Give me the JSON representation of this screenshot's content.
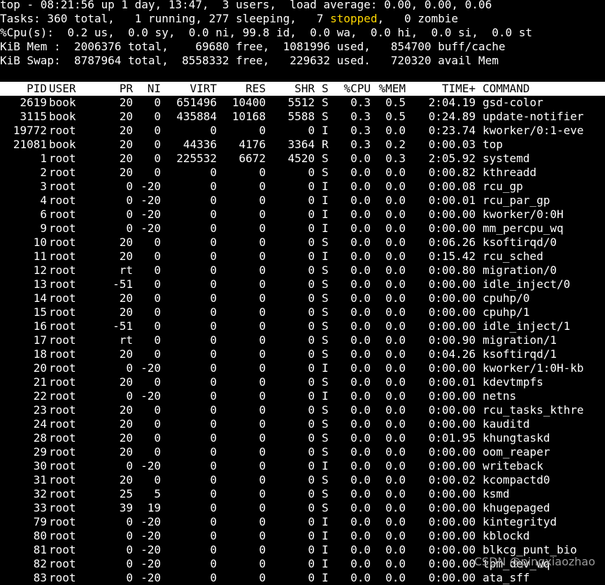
{
  "summary": {
    "line1": "top - 08:21:56 up 1 day, 13:47,  3 users,  load average: 0.00, 0.00, 0.06",
    "line2_a": "Tasks: 360 total,   1 running, 277 sleeping,   7 ",
    "line2_stopped": "stopped",
    "line2_b": ",   0 zombie",
    "line3": "%Cpu(s):  0.2 us,  0.0 sy,  0.0 ni, 99.8 id,  0.0 wa,  0.0 hi,  0.0 si,  0.0 st",
    "line4": "KiB Mem :  2006376 total,    69680 free,  1081996 used,   854700 buff/cache",
    "line5": "KiB Swap:  8787964 total,  8558332 free,   229632 used.   720320 avail Mem"
  },
  "columns": [
    "PID",
    "USER",
    "PR",
    "NI",
    "VIRT",
    "RES",
    "SHR",
    "S",
    "%CPU",
    "%MEM",
    "TIME+",
    "COMMAND"
  ],
  "processes": [
    [
      "2619",
      "book",
      "20",
      "0",
      "651496",
      "10400",
      "5512",
      "S",
      "0.3",
      "0.5",
      "2:04.19",
      "gsd-color"
    ],
    [
      "3115",
      "book",
      "20",
      "0",
      "435884",
      "10168",
      "5588",
      "S",
      "0.3",
      "0.5",
      "0:24.89",
      "update-notifier"
    ],
    [
      "19772",
      "root",
      "20",
      "0",
      "0",
      "0",
      "0",
      "I",
      "0.3",
      "0.0",
      "0:23.74",
      "kworker/0:1-eve"
    ],
    [
      "21081",
      "book",
      "20",
      "0",
      "44336",
      "4176",
      "3364",
      "R",
      "0.3",
      "0.2",
      "0:00.03",
      "top"
    ],
    [
      "1",
      "root",
      "20",
      "0",
      "225532",
      "6672",
      "4520",
      "S",
      "0.0",
      "0.3",
      "2:05.92",
      "systemd"
    ],
    [
      "2",
      "root",
      "20",
      "0",
      "0",
      "0",
      "0",
      "S",
      "0.0",
      "0.0",
      "0:00.82",
      "kthreadd"
    ],
    [
      "3",
      "root",
      "0",
      "-20",
      "0",
      "0",
      "0",
      "I",
      "0.0",
      "0.0",
      "0:00.08",
      "rcu_gp"
    ],
    [
      "4",
      "root",
      "0",
      "-20",
      "0",
      "0",
      "0",
      "I",
      "0.0",
      "0.0",
      "0:00.01",
      "rcu_par_gp"
    ],
    [
      "6",
      "root",
      "0",
      "-20",
      "0",
      "0",
      "0",
      "I",
      "0.0",
      "0.0",
      "0:00.00",
      "kworker/0:0H"
    ],
    [
      "9",
      "root",
      "0",
      "-20",
      "0",
      "0",
      "0",
      "I",
      "0.0",
      "0.0",
      "0:00.00",
      "mm_percpu_wq"
    ],
    [
      "10",
      "root",
      "20",
      "0",
      "0",
      "0",
      "0",
      "S",
      "0.0",
      "0.0",
      "0:06.26",
      "ksoftirqd/0"
    ],
    [
      "11",
      "root",
      "20",
      "0",
      "0",
      "0",
      "0",
      "I",
      "0.0",
      "0.0",
      "0:15.42",
      "rcu_sched"
    ],
    [
      "12",
      "root",
      "rt",
      "0",
      "0",
      "0",
      "0",
      "S",
      "0.0",
      "0.0",
      "0:00.80",
      "migration/0"
    ],
    [
      "13",
      "root",
      "-51",
      "0",
      "0",
      "0",
      "0",
      "S",
      "0.0",
      "0.0",
      "0:00.00",
      "idle_inject/0"
    ],
    [
      "14",
      "root",
      "20",
      "0",
      "0",
      "0",
      "0",
      "S",
      "0.0",
      "0.0",
      "0:00.00",
      "cpuhp/0"
    ],
    [
      "15",
      "root",
      "20",
      "0",
      "0",
      "0",
      "0",
      "S",
      "0.0",
      "0.0",
      "0:00.00",
      "cpuhp/1"
    ],
    [
      "16",
      "root",
      "-51",
      "0",
      "0",
      "0",
      "0",
      "S",
      "0.0",
      "0.0",
      "0:00.00",
      "idle_inject/1"
    ],
    [
      "17",
      "root",
      "rt",
      "0",
      "0",
      "0",
      "0",
      "S",
      "0.0",
      "0.0",
      "0:00.90",
      "migration/1"
    ],
    [
      "18",
      "root",
      "20",
      "0",
      "0",
      "0",
      "0",
      "S",
      "0.0",
      "0.0",
      "0:04.26",
      "ksoftirqd/1"
    ],
    [
      "20",
      "root",
      "0",
      "-20",
      "0",
      "0",
      "0",
      "I",
      "0.0",
      "0.0",
      "0:00.00",
      "kworker/1:0H-kb"
    ],
    [
      "21",
      "root",
      "20",
      "0",
      "0",
      "0",
      "0",
      "S",
      "0.0",
      "0.0",
      "0:00.01",
      "kdevtmpfs"
    ],
    [
      "22",
      "root",
      "0",
      "-20",
      "0",
      "0",
      "0",
      "I",
      "0.0",
      "0.0",
      "0:00.00",
      "netns"
    ],
    [
      "23",
      "root",
      "20",
      "0",
      "0",
      "0",
      "0",
      "S",
      "0.0",
      "0.0",
      "0:00.00",
      "rcu_tasks_kthre"
    ],
    [
      "24",
      "root",
      "20",
      "0",
      "0",
      "0",
      "0",
      "S",
      "0.0",
      "0.0",
      "0:00.00",
      "kauditd"
    ],
    [
      "28",
      "root",
      "20",
      "0",
      "0",
      "0",
      "0",
      "S",
      "0.0",
      "0.0",
      "0:01.95",
      "khungtaskd"
    ],
    [
      "29",
      "root",
      "20",
      "0",
      "0",
      "0",
      "0",
      "S",
      "0.0",
      "0.0",
      "0:00.00",
      "oom_reaper"
    ],
    [
      "30",
      "root",
      "0",
      "-20",
      "0",
      "0",
      "0",
      "I",
      "0.0",
      "0.0",
      "0:00.00",
      "writeback"
    ],
    [
      "31",
      "root",
      "20",
      "0",
      "0",
      "0",
      "0",
      "S",
      "0.0",
      "0.0",
      "0:00.02",
      "kcompactd0"
    ],
    [
      "32",
      "root",
      "25",
      "5",
      "0",
      "0",
      "0",
      "S",
      "0.0",
      "0.0",
      "0:00.00",
      "ksmd"
    ],
    [
      "33",
      "root",
      "39",
      "19",
      "0",
      "0",
      "0",
      "S",
      "0.0",
      "0.0",
      "0:00.00",
      "khugepaged"
    ],
    [
      "79",
      "root",
      "0",
      "-20",
      "0",
      "0",
      "0",
      "I",
      "0.0",
      "0.0",
      "0:00.00",
      "kintegrityd"
    ],
    [
      "80",
      "root",
      "0",
      "-20",
      "0",
      "0",
      "0",
      "I",
      "0.0",
      "0.0",
      "0:00.00",
      "kblockd"
    ],
    [
      "81",
      "root",
      "0",
      "-20",
      "0",
      "0",
      "0",
      "I",
      "0.0",
      "0.0",
      "0:00.00",
      "blkcg_punt_bio"
    ],
    [
      "82",
      "root",
      "0",
      "-20",
      "0",
      "0",
      "0",
      "I",
      "0.0",
      "0.0",
      "0:00.00",
      "tpm_dev_wq"
    ],
    [
      "83",
      "root",
      "0",
      "-20",
      "0",
      "0",
      "0",
      "I",
      "0.0",
      "0.0",
      "0:00.00",
      "ata_sff"
    ]
  ],
  "watermark": "CSDN @pingxiaozhao",
  "colors": {
    "background": "#000000",
    "text": "#ffffff",
    "stopped": "#ffd700",
    "header_bg": "#ffffff"
  }
}
